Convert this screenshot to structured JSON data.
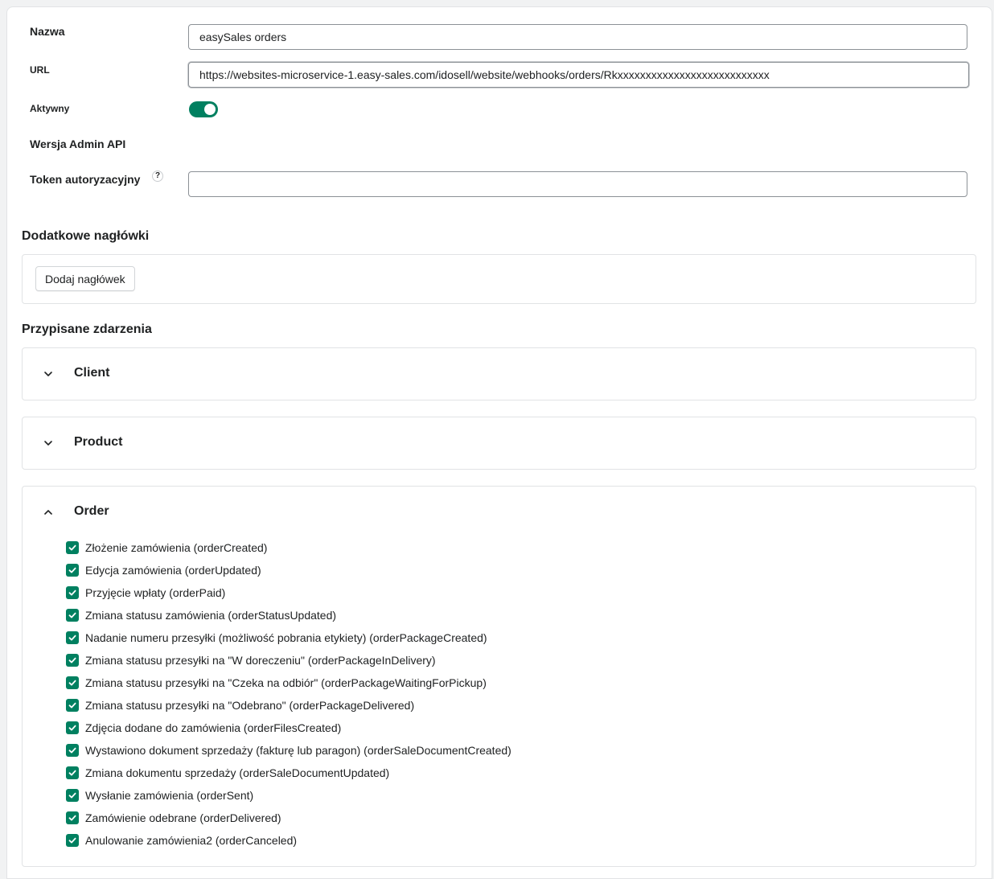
{
  "form": {
    "name_label": "Nazwa",
    "name_value": "easySales orders",
    "url_label": "URL",
    "url_value": "https://websites-microservice-1.easy-sales.com/idosell/website/webhooks/orders/Rkxxxxxxxxxxxxxxxxxxxxxxxxxxx",
    "active_label": "Aktywny",
    "active_on": true,
    "api_version_label": "Wersja Admin API",
    "token_label": "Token autoryzacyjny",
    "token_help": "?",
    "token_value": ""
  },
  "headers_section": {
    "title": "Dodatkowe nagłówki",
    "add_button": "Dodaj nagłówek"
  },
  "events_section": {
    "title": "Przypisane zdarzenia",
    "groups": [
      {
        "label": "Client",
        "expanded": false
      },
      {
        "label": "Product",
        "expanded": false
      },
      {
        "label": "Order",
        "expanded": true
      }
    ],
    "order_events": [
      "Złożenie zamówienia (orderCreated)",
      "Edycja zamówienia (orderUpdated)",
      "Przyjęcie wpłaty (orderPaid)",
      "Zmiana statusu zamówienia (orderStatusUpdated)",
      "Nadanie numeru przesyłki (możliwość pobrania etykiety) (orderPackageCreated)",
      "Zmiana statusu przesyłki na \"W doreczeniu\" (orderPackageInDelivery)",
      "Zmiana statusu przesyłki na \"Czeka na odbiór\" (orderPackageWaitingForPickup)",
      "Zmiana statusu przesyłki na \"Odebrano\" (orderPackageDelivered)",
      "Zdjęcia dodane do zamówienia (orderFilesCreated)",
      "Wystawiono dokument sprzedaży (fakturę lub paragon) (orderSaleDocumentCreated)",
      "Zmiana dokumentu sprzedaży (orderSaleDocumentUpdated)",
      "Wysłanie zamówienia (orderSent)",
      "Zamówienie odebrane (orderDelivered)",
      "Anulowanie zamówienia2 (orderCanceled)"
    ]
  },
  "colors": {
    "accent": "#008060",
    "border": "#e1e3e5",
    "text": "#202223"
  }
}
